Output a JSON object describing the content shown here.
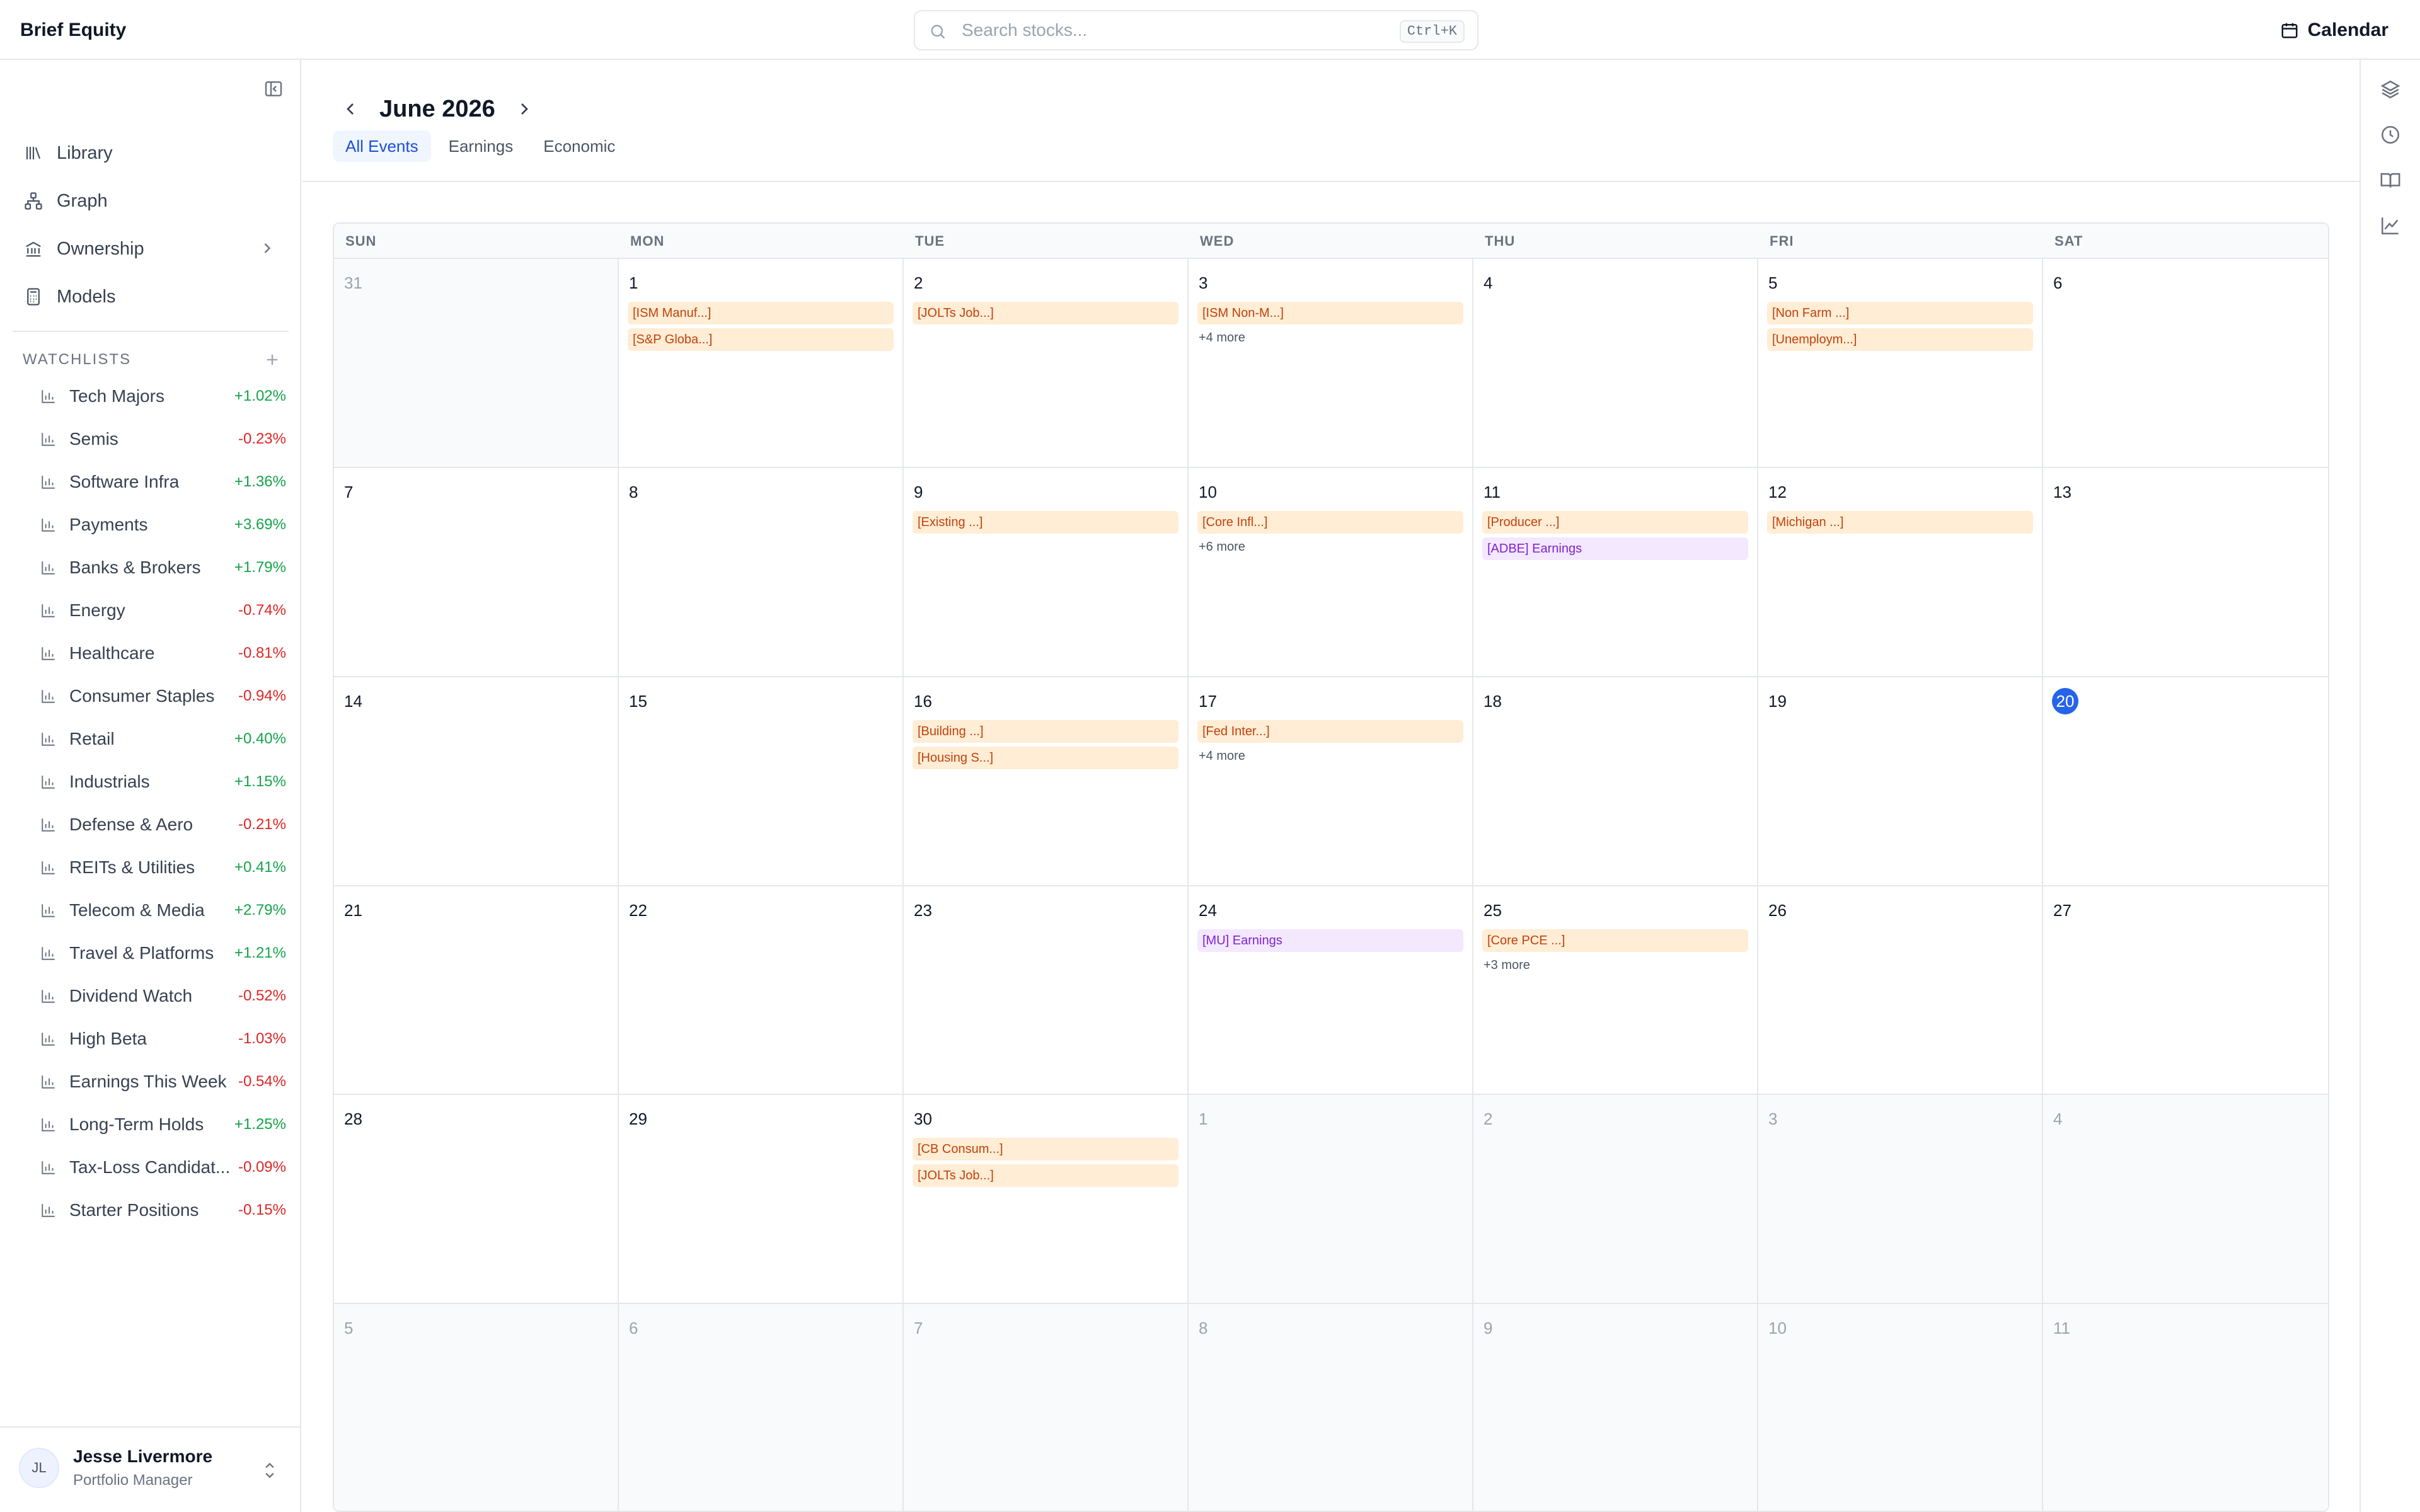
{
  "app": {
    "brand": "Brief Equity"
  },
  "search": {
    "placeholder": "Search stocks...",
    "shortcut": "Ctrl+K"
  },
  "header": {
    "calendar_label": "Calendar"
  },
  "sidebar": {
    "nav": [
      {
        "label": "Library",
        "icon": "library-icon"
      },
      {
        "label": "Graph",
        "icon": "graph-icon"
      },
      {
        "label": "Ownership",
        "icon": "bank-icon"
      },
      {
        "label": "Models",
        "icon": "calculator-icon"
      }
    ],
    "watchlists_title": "WATCHLISTS",
    "watchlists": [
      {
        "name": "Tech Majors",
        "change": "+1.02%",
        "dir": "pos"
      },
      {
        "name": "Semis",
        "change": "-0.23%",
        "dir": "neg"
      },
      {
        "name": "Software Infra",
        "change": "+1.36%",
        "dir": "pos"
      },
      {
        "name": "Payments",
        "change": "+3.69%",
        "dir": "pos"
      },
      {
        "name": "Banks & Brokers",
        "change": "+1.79%",
        "dir": "pos"
      },
      {
        "name": "Energy",
        "change": "-0.74%",
        "dir": "neg"
      },
      {
        "name": "Healthcare",
        "change": "-0.81%",
        "dir": "neg"
      },
      {
        "name": "Consumer Staples",
        "change": "-0.94%",
        "dir": "neg"
      },
      {
        "name": "Retail",
        "change": "+0.40%",
        "dir": "pos"
      },
      {
        "name": "Industrials",
        "change": "+1.15%",
        "dir": "pos"
      },
      {
        "name": "Defense & Aero",
        "change": "-0.21%",
        "dir": "neg"
      },
      {
        "name": "REITs & Utilities",
        "change": "+0.41%",
        "dir": "pos"
      },
      {
        "name": "Telecom & Media",
        "change": "+2.79%",
        "dir": "pos"
      },
      {
        "name": "Travel & Platforms",
        "change": "+1.21%",
        "dir": "pos"
      },
      {
        "name": "Dividend Watch",
        "change": "-0.52%",
        "dir": "neg"
      },
      {
        "name": "High Beta",
        "change": "-1.03%",
        "dir": "neg"
      },
      {
        "name": "Earnings This Week",
        "change": "-0.54%",
        "dir": "neg"
      },
      {
        "name": "Long-Term Holds",
        "change": "+1.25%",
        "dir": "pos"
      },
      {
        "name": "Tax-Loss Candidat...",
        "change": "-0.09%",
        "dir": "neg"
      },
      {
        "name": "Starter Positions",
        "change": "-0.15%",
        "dir": "neg"
      }
    ],
    "user": {
      "initials": "JL",
      "name": "Jesse Livermore",
      "role": "Portfolio Manager"
    }
  },
  "calendar": {
    "month_label": "June 2026",
    "tabs": [
      {
        "label": "All Events",
        "active": true
      },
      {
        "label": "Earnings",
        "active": false
      },
      {
        "label": "Economic",
        "active": false
      }
    ],
    "weekdays": [
      "SUN",
      "MON",
      "TUE",
      "WED",
      "THU",
      "FRI",
      "SAT"
    ],
    "days": [
      {
        "day": "31",
        "out": true,
        "events": []
      },
      {
        "day": "1",
        "events": [
          {
            "label": "[ISM Manuf...]",
            "kind": "econ"
          },
          {
            "label": "[S&P Globa...]",
            "kind": "econ"
          }
        ]
      },
      {
        "day": "2",
        "events": [
          {
            "label": "[JOLTs Job...]",
            "kind": "econ"
          }
        ]
      },
      {
        "day": "3",
        "events": [
          {
            "label": "[ISM Non-M...]",
            "kind": "econ"
          }
        ],
        "more": "+4 more"
      },
      {
        "day": "4",
        "events": []
      },
      {
        "day": "5",
        "events": [
          {
            "label": "[Non Farm ...]",
            "kind": "econ"
          },
          {
            "label": "[Unemploym...]",
            "kind": "econ"
          }
        ]
      },
      {
        "day": "6",
        "events": []
      },
      {
        "day": "7",
        "events": []
      },
      {
        "day": "8",
        "events": []
      },
      {
        "day": "9",
        "events": [
          {
            "label": "[Existing ...]",
            "kind": "econ"
          }
        ]
      },
      {
        "day": "10",
        "events": [
          {
            "label": "[Core Infl...]",
            "kind": "econ"
          }
        ],
        "more": "+6 more"
      },
      {
        "day": "11",
        "events": [
          {
            "label": "[Producer ...]",
            "kind": "econ"
          },
          {
            "label": "[ADBE] Earnings",
            "kind": "earn"
          }
        ]
      },
      {
        "day": "12",
        "events": [
          {
            "label": "[Michigan ...]",
            "kind": "econ"
          }
        ]
      },
      {
        "day": "13",
        "events": []
      },
      {
        "day": "14",
        "events": []
      },
      {
        "day": "15",
        "events": []
      },
      {
        "day": "16",
        "events": [
          {
            "label": "[Building ...]",
            "kind": "econ"
          },
          {
            "label": "[Housing S...]",
            "kind": "econ"
          }
        ]
      },
      {
        "day": "17",
        "events": [
          {
            "label": "[Fed Inter...]",
            "kind": "econ"
          }
        ],
        "more": "+4 more"
      },
      {
        "day": "18",
        "events": []
      },
      {
        "day": "19",
        "events": []
      },
      {
        "day": "20",
        "today": true,
        "events": []
      },
      {
        "day": "21",
        "events": []
      },
      {
        "day": "22",
        "events": []
      },
      {
        "day": "23",
        "events": []
      },
      {
        "day": "24",
        "events": [
          {
            "label": "[MU] Earnings",
            "kind": "earn"
          }
        ]
      },
      {
        "day": "25",
        "events": [
          {
            "label": "[Core PCE ...]",
            "kind": "econ"
          }
        ],
        "more": "+3 more"
      },
      {
        "day": "26",
        "events": []
      },
      {
        "day": "27",
        "events": []
      },
      {
        "day": "28",
        "events": []
      },
      {
        "day": "29",
        "events": []
      },
      {
        "day": "30",
        "events": [
          {
            "label": "[CB Consum...]",
            "kind": "econ"
          },
          {
            "label": "[JOLTs Job...]",
            "kind": "econ"
          }
        ]
      },
      {
        "day": "1",
        "out": true,
        "events": []
      },
      {
        "day": "2",
        "out": true,
        "events": []
      },
      {
        "day": "3",
        "out": true,
        "events": []
      },
      {
        "day": "4",
        "out": true,
        "events": []
      },
      {
        "day": "5",
        "out": true,
        "events": []
      },
      {
        "day": "6",
        "out": true,
        "events": []
      },
      {
        "day": "7",
        "out": true,
        "events": []
      },
      {
        "day": "8",
        "out": true,
        "events": []
      },
      {
        "day": "9",
        "out": true,
        "events": []
      },
      {
        "day": "10",
        "out": true,
        "events": []
      },
      {
        "day": "11",
        "out": true,
        "events": []
      }
    ]
  },
  "colors": {
    "accent": "#2563eb",
    "positive": "#16a34a",
    "negative": "#dc2626",
    "economic_event_bg": "#ffedd5",
    "earnings_event_bg": "#f3e8ff"
  },
  "rail_icons": [
    "layers-icon",
    "clock-icon",
    "book-icon",
    "line-chart-icon"
  ]
}
